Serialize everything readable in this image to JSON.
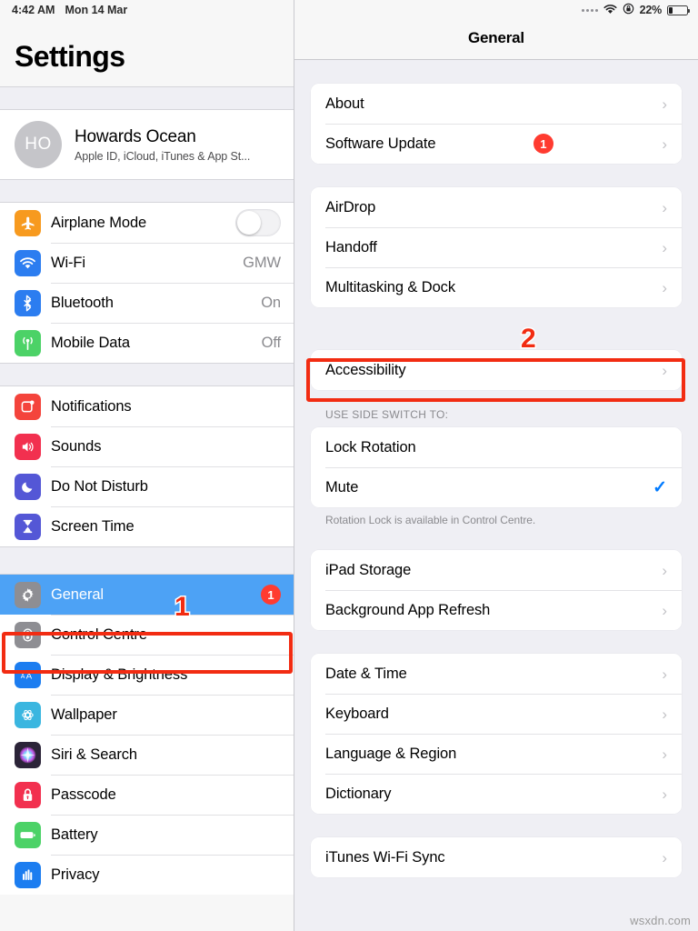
{
  "statusbar": {
    "time": "4:42 AM",
    "date": "Mon 14 Mar",
    "battery_percent": "22%",
    "icons": [
      "signal-dots-icon",
      "wifi-icon",
      "rotation-lock-icon",
      "battery-icon"
    ]
  },
  "sidebar": {
    "title": "Settings",
    "account": {
      "initials": "HO",
      "name": "Howards Ocean",
      "subtitle": "Apple ID, iCloud, iTunes & App St..."
    },
    "groups": [
      {
        "items": [
          {
            "label": "Airplane Mode",
            "icon": "airplane-icon",
            "icon_color": "#f79a1f",
            "control": "toggle",
            "toggle_on": false
          },
          {
            "label": "Wi-Fi",
            "icon": "wifi-icon",
            "icon_color": "#2c7df0",
            "value": "GMW"
          },
          {
            "label": "Bluetooth",
            "icon": "bluetooth-icon",
            "icon_color": "#2c7df0",
            "value": "On"
          },
          {
            "label": "Mobile Data",
            "icon": "cellular-icon",
            "icon_color": "#4cd267",
            "value": "Off"
          }
        ]
      },
      {
        "items": [
          {
            "label": "Notifications",
            "icon": "notifications-icon",
            "icon_color": "#f4443c"
          },
          {
            "label": "Sounds",
            "icon": "speaker-icon",
            "icon_color": "#f2304f"
          },
          {
            "label": "Do Not Disturb",
            "icon": "moon-icon",
            "icon_color": "#5457d6"
          },
          {
            "label": "Screen Time",
            "icon": "hourglass-icon",
            "icon_color": "#5457d6"
          }
        ]
      },
      {
        "items": [
          {
            "label": "General",
            "icon": "gear-icon",
            "icon_color": "#8e8e93",
            "selected": true,
            "badge": "1"
          },
          {
            "label": "Control Centre",
            "icon": "control-centre-icon",
            "icon_color": "#8e8e93"
          },
          {
            "label": "Display & Brightness",
            "icon": "display-brightness-icon",
            "icon_color": "#1c7df0"
          },
          {
            "label": "Wallpaper",
            "icon": "wallpaper-icon",
            "icon_color": "#3ab6e0"
          },
          {
            "label": "Siri & Search",
            "icon": "siri-icon",
            "icon_color": "#2b2438"
          },
          {
            "label": "Passcode",
            "icon": "lock-icon",
            "icon_color": "#f2304f"
          },
          {
            "label": "Battery",
            "icon": "battery-icon",
            "icon_color": "#4cd267"
          },
          {
            "label": "Privacy",
            "icon": "privacy-hand-icon",
            "icon_color": "#1c7df0"
          }
        ]
      }
    ]
  },
  "detail": {
    "title": "General",
    "groups": [
      {
        "rows": [
          {
            "label": "About",
            "chevron": true
          },
          {
            "label": "Software Update",
            "chevron": true,
            "badge": "1"
          }
        ]
      },
      {
        "rows": [
          {
            "label": "AirDrop",
            "chevron": true
          },
          {
            "label": "Handoff",
            "chevron": true
          },
          {
            "label": "Multitasking & Dock",
            "chevron": true
          }
        ]
      },
      {
        "rows": [
          {
            "label": "Accessibility",
            "chevron": true
          }
        ]
      },
      {
        "header": "USE SIDE SWITCH TO:",
        "footer": "Rotation Lock is available in Control Centre.",
        "rows": [
          {
            "label": "Lock Rotation"
          },
          {
            "label": "Mute",
            "checked": true
          }
        ]
      },
      {
        "rows": [
          {
            "label": "iPad Storage",
            "chevron": true
          },
          {
            "label": "Background App Refresh",
            "chevron": true
          }
        ]
      },
      {
        "rows": [
          {
            "label": "Date & Time",
            "chevron": true
          },
          {
            "label": "Keyboard",
            "chevron": true
          },
          {
            "label": "Language & Region",
            "chevron": true
          },
          {
            "label": "Dictionary",
            "chevron": true
          }
        ]
      },
      {
        "rows": [
          {
            "label": "iTunes Wi-Fi Sync",
            "chevron": true
          }
        ]
      }
    ]
  },
  "annotations": {
    "step_one": "1",
    "step_two": "2",
    "color": "#f22c12"
  },
  "watermark": "wsxdn.com"
}
